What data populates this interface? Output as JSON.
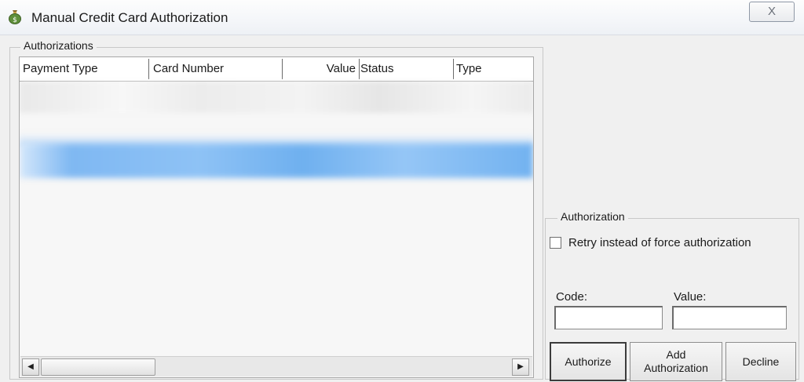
{
  "window": {
    "title": "Manual Credit Card Authorization",
    "close_glyph": "X"
  },
  "authorizations_group": {
    "legend": "Authorizations",
    "columns": [
      "Payment Type",
      "Card Number",
      "Value",
      "Status",
      "Type"
    ]
  },
  "authorization_group": {
    "legend": "Authorization",
    "retry_checkbox_label": "Retry instead of force authorization",
    "retry_checked": false,
    "code_label": "Code:",
    "code_value": "",
    "value_label": "Value:",
    "value_value": ""
  },
  "buttons": {
    "authorize": "Authorize",
    "add_authorization_line1": "Add",
    "add_authorization_line2": "Authorization",
    "decline": "Decline"
  },
  "scrollbar": {
    "left_arrow": "◀",
    "right_arrow": "▶"
  },
  "colors": {
    "selection_blue": "#7fb8f2",
    "window_bg": "#f0f0f0"
  }
}
